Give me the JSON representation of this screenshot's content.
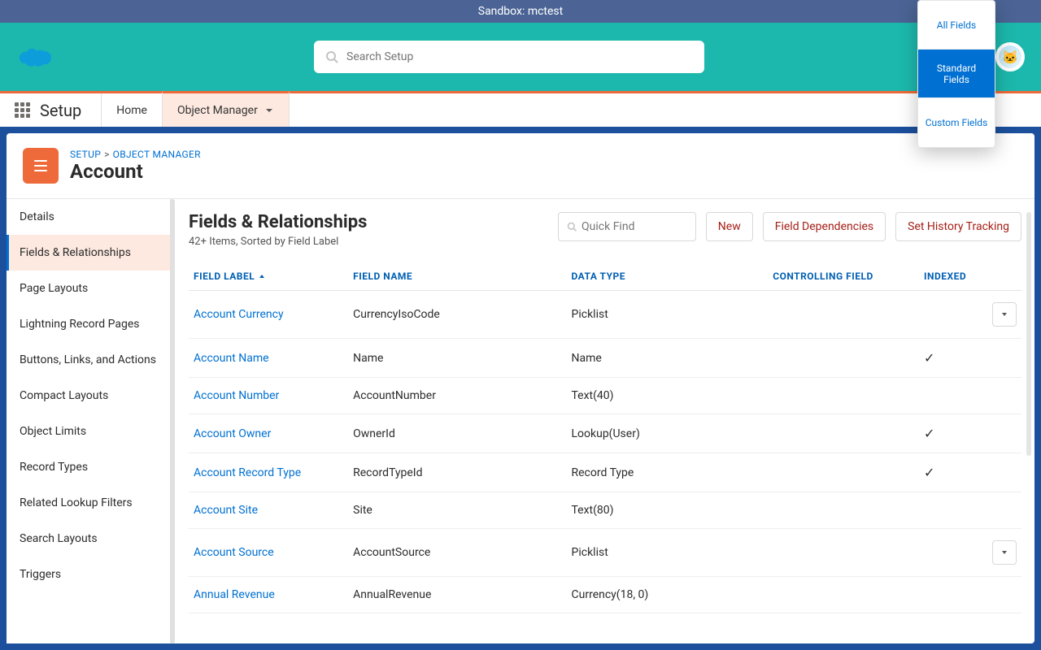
{
  "sandbox_banner": "Sandbox: mctest",
  "search_placeholder": "Search Setup",
  "nav": {
    "setup_label": "Setup",
    "tabs": [
      {
        "label": "Home"
      },
      {
        "label": "Object Manager"
      }
    ]
  },
  "breadcrumb": {
    "root": "SETUP",
    "parent": "OBJECT MANAGER",
    "title": "Account"
  },
  "sidebar": {
    "items": [
      "Details",
      "Fields & Relationships",
      "Page Layouts",
      "Lightning Record Pages",
      "Buttons, Links, and Actions",
      "Compact Layouts",
      "Object Limits",
      "Record Types",
      "Related Lookup Filters",
      "Search Layouts",
      "Triggers"
    ],
    "active_index": 1
  },
  "page": {
    "title": "Fields & Relationships",
    "subtitle": "42+ Items, Sorted by Field Label",
    "quick_find_placeholder": "Quick Find",
    "buttons": {
      "new": "New",
      "deps": "Field Dependencies",
      "history": "Set History Tracking"
    }
  },
  "table": {
    "columns": [
      "FIELD LABEL",
      "FIELD NAME",
      "DATA TYPE",
      "CONTROLLING FIELD",
      "INDEXED"
    ],
    "rows": [
      {
        "label": "Account Currency",
        "name": "CurrencyIsoCode",
        "type": "Picklist",
        "controlling": "",
        "indexed": false,
        "menu": true
      },
      {
        "label": "Account Name",
        "name": "Name",
        "type": "Name",
        "controlling": "",
        "indexed": true,
        "menu": false
      },
      {
        "label": "Account Number",
        "name": "AccountNumber",
        "type": "Text(40)",
        "controlling": "",
        "indexed": false,
        "menu": false
      },
      {
        "label": "Account Owner",
        "name": "OwnerId",
        "type": "Lookup(User)",
        "controlling": "",
        "indexed": true,
        "menu": false
      },
      {
        "label": "Account Record Type",
        "name": "RecordTypeId",
        "type": "Record Type",
        "controlling": "",
        "indexed": true,
        "menu": false
      },
      {
        "label": "Account Site",
        "name": "Site",
        "type": "Text(80)",
        "controlling": "",
        "indexed": false,
        "menu": false
      },
      {
        "label": "Account Source",
        "name": "AccountSource",
        "type": "Picklist",
        "controlling": "",
        "indexed": false,
        "menu": true
      },
      {
        "label": "Annual Revenue",
        "name": "AnnualRevenue",
        "type": "Currency(18, 0)",
        "controlling": "",
        "indexed": false,
        "menu": false
      }
    ]
  },
  "float_menu": {
    "items": [
      "All Fields",
      "Standard Fields",
      "Custom Fields"
    ],
    "active_index": 1
  }
}
